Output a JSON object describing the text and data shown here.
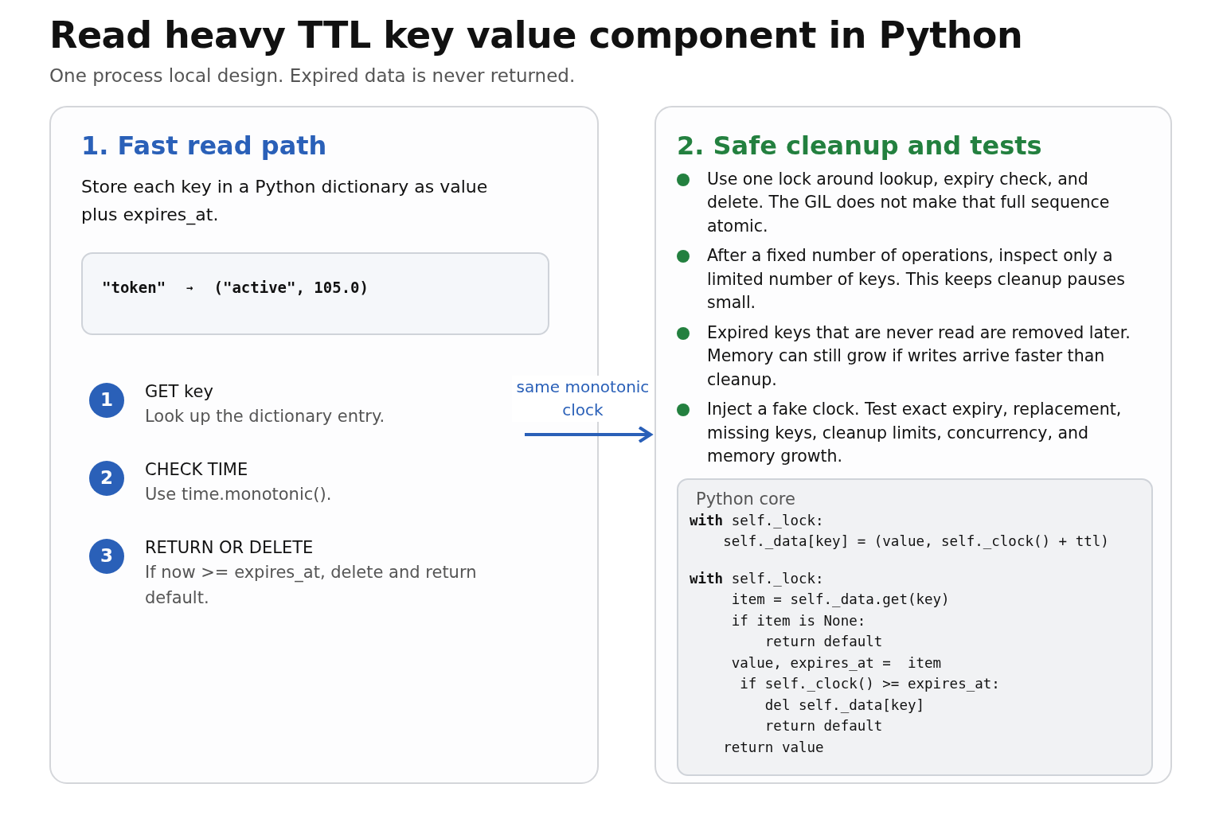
{
  "title": "Read heavy TTL key value component in Python",
  "subtitle": "One process local design. Expired data is never returned.",
  "left_panel": {
    "heading": "1. Fast read path",
    "intro": "Store each key in a Python dictionary as value plus expires_at.",
    "mapping": {
      "key": "\"token\"",
      "arrow": "→",
      "value": "(\"active\", 105.0)"
    },
    "steps": [
      {
        "number": "1",
        "title": "GET key",
        "detail": "Look up the dictionary entry."
      },
      {
        "number": "2",
        "title": "CHECK TIME",
        "detail": "Use time.monotonic()."
      },
      {
        "number": "3",
        "title": "RETURN OR DELETE",
        "detail": "If now >= expires_at, delete and return default."
      }
    ]
  },
  "connector": {
    "label": "same monotonic clock"
  },
  "right_panel": {
    "heading": "2. Safe cleanup and tests",
    "bullets": [
      "Use one lock around lookup, expiry check, and delete. The GIL does not make that full sequence atomic.",
      "After a fixed number of operations, inspect only a limited number of keys. This keeps cleanup pauses small.",
      "Expired keys that are never read are removed later. Memory can still grow if writes arrive faster than cleanup.",
      "Inject a fake clock. Test exact expiry, replacement, missing keys, cleanup limits, concurrency, and memory growth."
    ],
    "code": {
      "caption": "Python core",
      "blocks": [
        [
          "**with** self._lock:",
          "    self._data[key] = (value, self._clock() + ttl)"
        ],
        [
          "**with** self._lock:",
          "     item = self._data.get(key)",
          "     if item is None:",
          "         return default",
          "     value, expires_at =  item",
          "      if self._clock() >= expires_at:",
          "         del self._data[key]",
          "         return default",
          "    return value"
        ]
      ]
    }
  }
}
